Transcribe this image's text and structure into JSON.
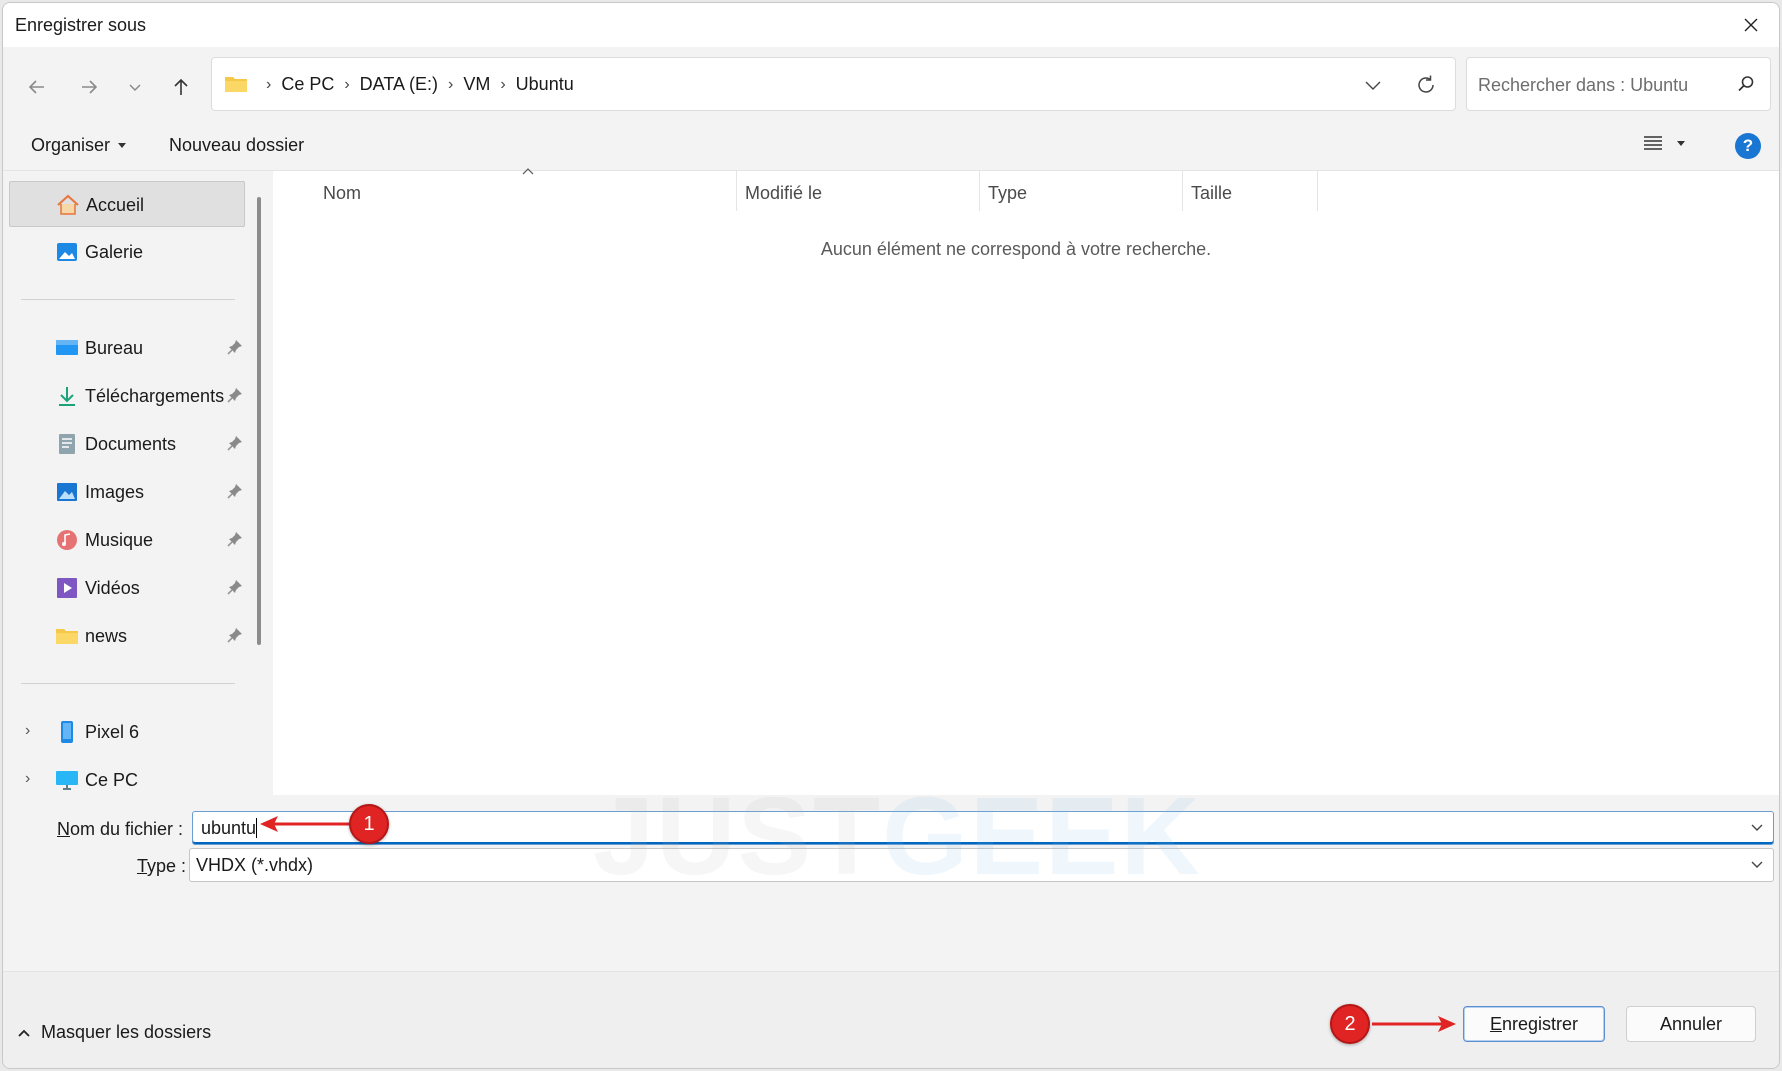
{
  "window": {
    "title": "Enregistrer sous"
  },
  "address": {
    "crumbs": [
      "Ce PC",
      "DATA (E:)",
      "VM",
      "Ubuntu"
    ]
  },
  "search": {
    "placeholder": "Rechercher dans : Ubuntu"
  },
  "toolbar": {
    "organize_label": "Organiser",
    "new_folder_label": "Nouveau dossier",
    "help_label": "?"
  },
  "sidebar": {
    "top_items": [
      {
        "label": "Accueil",
        "icon": "home-icon"
      },
      {
        "label": "Galerie",
        "icon": "gallery-icon"
      }
    ],
    "pinned_items": [
      {
        "label": "Bureau",
        "icon": "desktop-icon"
      },
      {
        "label": "Téléchargements",
        "icon": "download-icon"
      },
      {
        "label": "Documents",
        "icon": "documents-icon"
      },
      {
        "label": "Images",
        "icon": "images-icon"
      },
      {
        "label": "Musique",
        "icon": "music-icon"
      },
      {
        "label": "Vidéos",
        "icon": "videos-icon"
      },
      {
        "label": "news",
        "icon": "folder-icon"
      }
    ],
    "devices": [
      {
        "label": "Pixel 6",
        "icon": "phone-icon"
      },
      {
        "label": "Ce PC",
        "icon": "computer-icon"
      }
    ]
  },
  "filelist": {
    "columns": [
      "Nom",
      "Modifié le",
      "Type",
      "Taille"
    ],
    "empty_message": "Aucun élément ne correspond à votre recherche."
  },
  "form": {
    "filename_label_mnemonic": "N",
    "filename_label_rest": "om du fichier :",
    "filename_value": "ubuntu",
    "type_label_mnemonic": "T",
    "type_label_rest": "ype :",
    "type_value": "VHDX (*.vhdx)"
  },
  "footer": {
    "hide_folders_label": "Masquer les dossiers",
    "save_label_mnemonic": "E",
    "save_label_rest": "nregistrer",
    "cancel_label": "Annuler"
  },
  "annotations": {
    "step1": "1",
    "step2": "2",
    "color": "#e02424"
  },
  "watermark": {
    "part1": "JUST",
    "part2": "GEEK"
  },
  "colors": {
    "accent": "#0067c0",
    "help": "#1976d2"
  }
}
